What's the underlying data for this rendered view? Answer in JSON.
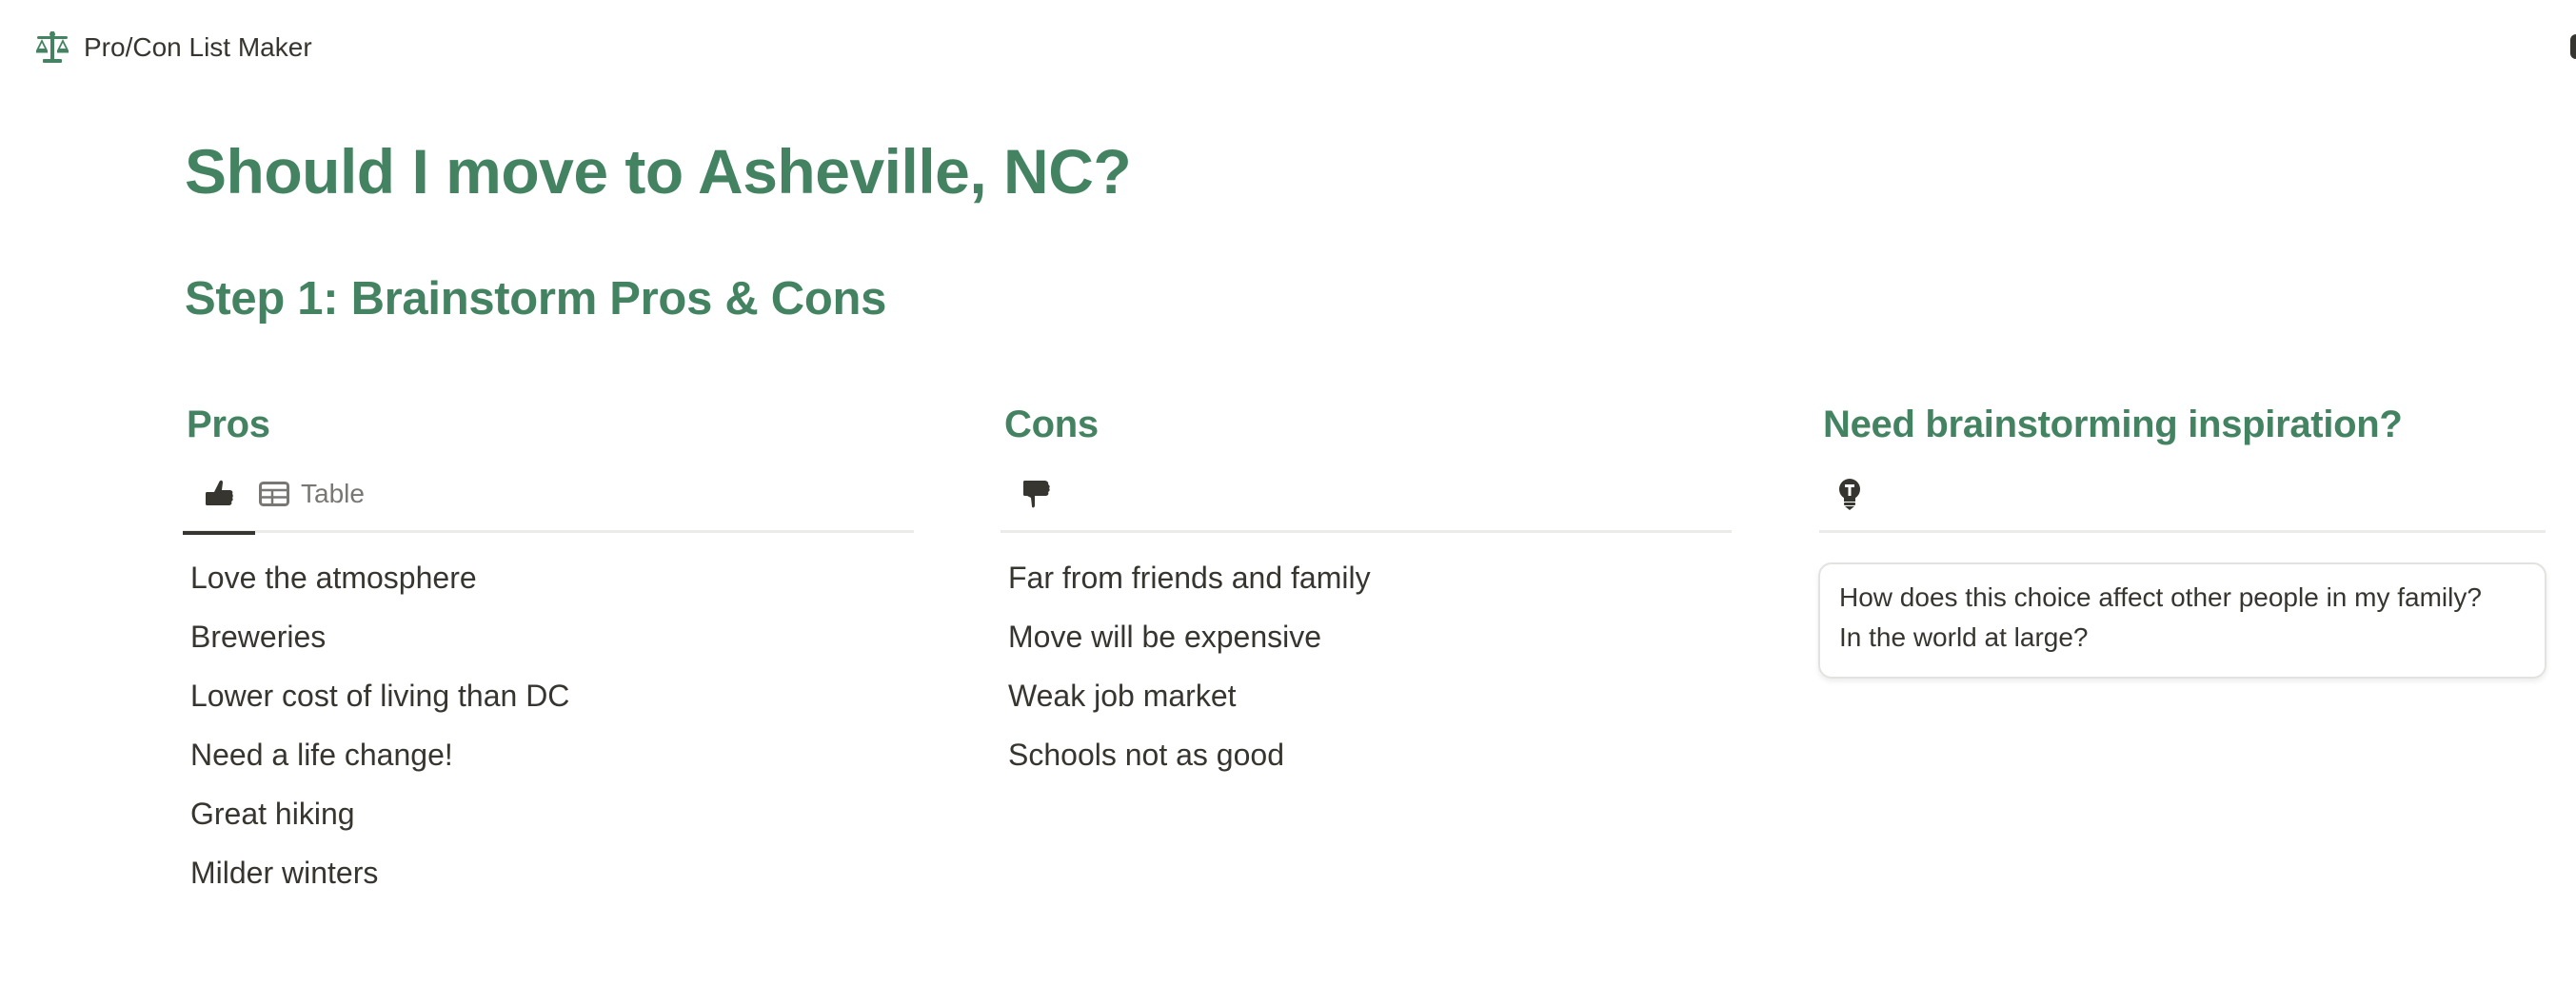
{
  "app": {
    "title": "Pro/Con List Maker",
    "icon": "scales-icon",
    "accent_color": "#448361"
  },
  "page": {
    "title": "Should I move to Asheville, NC?",
    "step_heading": "Step 1: Brainstorm Pros & Cons"
  },
  "pros": {
    "heading": "Pros",
    "tabs": [
      {
        "icon": "thumbs-up-icon",
        "label": "",
        "active": true
      },
      {
        "icon": "table-icon",
        "label": "Table",
        "active": false
      }
    ],
    "items": [
      "Love the atmosphere",
      "Breweries",
      "Lower cost of living than DC",
      "Need a life change!",
      "Great hiking",
      "Milder winters"
    ]
  },
  "cons": {
    "heading": "Cons",
    "tabs": [
      {
        "icon": "thumbs-down-icon",
        "label": "",
        "active": false
      }
    ],
    "items": [
      "Far from friends and family",
      "Move will be expensive",
      "Weak job market",
      "Schools not as good"
    ]
  },
  "inspiration": {
    "heading": "Need brainstorming inspiration?",
    "tabs": [
      {
        "icon": "lightbulb-icon",
        "label": "",
        "active": false
      }
    ],
    "cards": [
      {
        "text_line1": "How does this choice affect other people in my family?",
        "text_line2": "In the world at large?"
      }
    ]
  }
}
